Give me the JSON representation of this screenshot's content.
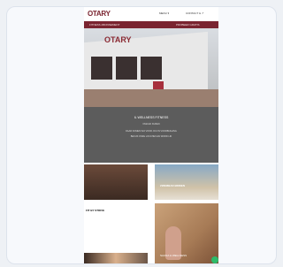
{
  "header": {
    "logo": "OTARY",
    "links": [
      "MENU ▾",
      "CONTACT & ↗"
    ]
  },
  "redbar": {
    "left": "FITNESS ABONNEMENT",
    "right": "PROBEER GRATIS"
  },
  "hero": {
    "roof_sign": "OTARY"
  },
  "dark_section": {
    "title": "IL WELLNESS FITNESS",
    "line1": "OMA EN KUREN",
    "line2": "DAAR KOMEN WIJ VOOR JOU IN VOORBIJGANG",
    "line3": "BEKIJK ONZE LOCATIES EN WORD LID"
  },
  "tiles": [
    {
      "caption": ""
    },
    {
      "caption": "ZWEMBAD BINNEN"
    },
    {
      "caption": "FIT BY STRIVE"
    },
    {
      "caption": "SAUNA & WELLNESS"
    }
  ],
  "colors": {
    "brand": "#7a2430",
    "dark_section": "#5c5c5c",
    "chat": "#2dbb6a"
  },
  "icons": {
    "chat": "chat-bubble-icon"
  }
}
